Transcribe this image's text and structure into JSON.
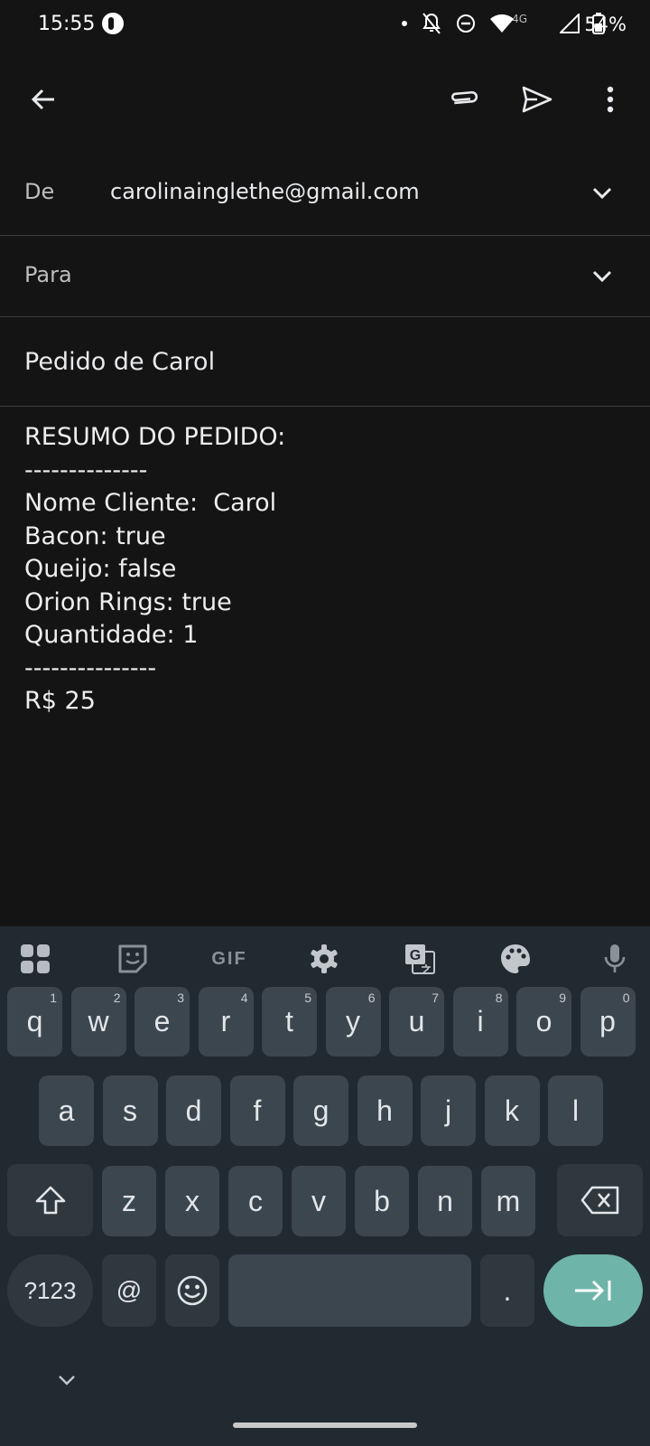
{
  "status_bar": {
    "time": "15:55",
    "network_label": "4G",
    "battery": "54%"
  },
  "toolbar": {
    "back_icon": "arrow-back-icon",
    "attach_icon": "paperclip-icon",
    "send_icon": "send-icon",
    "more_icon": "more-vert-icon"
  },
  "compose": {
    "from_label": "De",
    "from_value": "carolinainglethe@gmail.com",
    "to_label": "Para",
    "to_value": "",
    "subject": "Pedido de Carol",
    "body": "RESUMO DO PEDIDO:\n--------------\nNome Cliente:  Carol\nBacon: true\nQueijo: false\nOrion Rings: true\nQuantidade: 1\n---------------\nR$ 25"
  },
  "keyboard": {
    "toolbar": {
      "gif_label": "GIF"
    },
    "row1": [
      {
        "key": "q",
        "hint": "1"
      },
      {
        "key": "w",
        "hint": "2"
      },
      {
        "key": "e",
        "hint": "3"
      },
      {
        "key": "r",
        "hint": "4"
      },
      {
        "key": "t",
        "hint": "5"
      },
      {
        "key": "y",
        "hint": "6"
      },
      {
        "key": "u",
        "hint": "7"
      },
      {
        "key": "i",
        "hint": "8"
      },
      {
        "key": "o",
        "hint": "9"
      },
      {
        "key": "p",
        "hint": "0"
      }
    ],
    "row2": [
      "a",
      "s",
      "d",
      "f",
      "g",
      "h",
      "j",
      "k",
      "l"
    ],
    "row3": [
      "z",
      "x",
      "c",
      "v",
      "b",
      "n",
      "m"
    ],
    "symbols_label": "?123",
    "at_label": "@",
    "period_label": "."
  },
  "colors": {
    "background": "#141414",
    "keyboard_bg": "#222a31",
    "key_bg": "#3c464f",
    "enter_key": "#6fb4a9"
  }
}
